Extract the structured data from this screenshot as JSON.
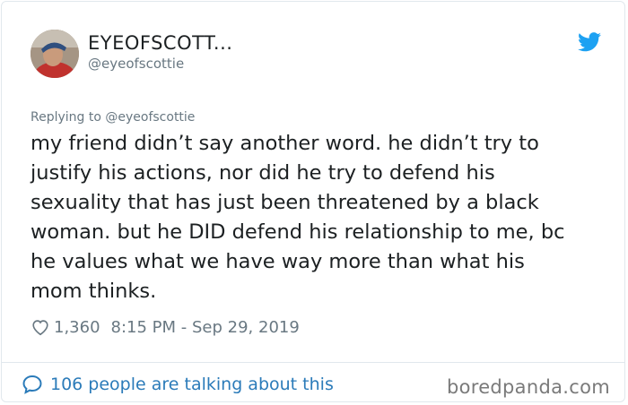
{
  "tweet": {
    "display_name": "EYEOFSCOTT...",
    "handle": "@eyeofscottie",
    "replying_to": "Replying to @eyeofscottie",
    "text": "my friend didn’t say another word. he didn’t try to\njustify his actions, nor did he try to defend his\nsexuality that has just been threatened by a black\nwoman. but he DID defend his relationship to me, bc\nhe values what we have way more than what his\nmom thinks.",
    "likes": "1,360",
    "timestamp": "8:15 PM - Sep 29, 2019",
    "conversation": "106 people are talking about this"
  },
  "watermark": "boredpanda.com",
  "icons": {
    "brand": "twitter-bird-icon",
    "like": "heart-icon",
    "reply": "speech-bubble-icon"
  },
  "colors": {
    "twitter_blue": "#1da1f2",
    "link_blue": "#2b7bb9",
    "meta_gray": "#697882",
    "text": "#1c2022",
    "border": "#e1e8ed"
  }
}
